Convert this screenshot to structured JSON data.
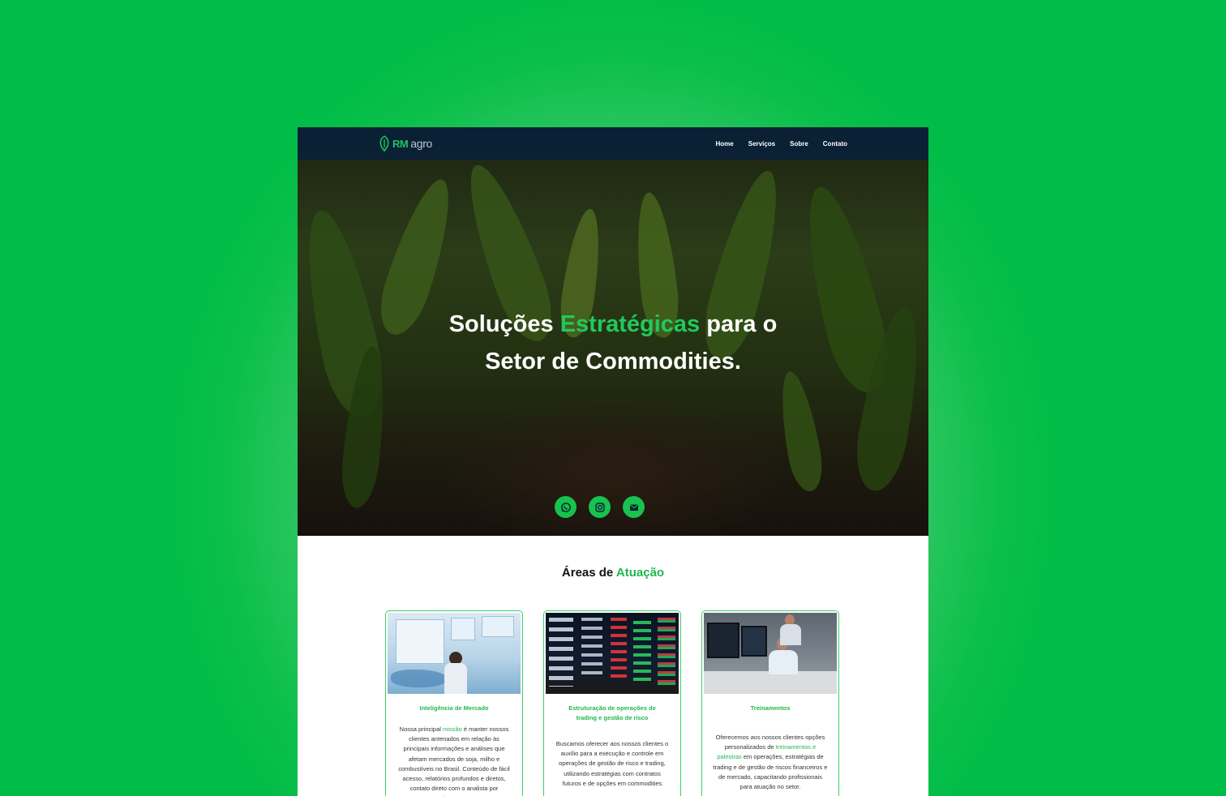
{
  "brand": {
    "rm": "RM",
    "agro": "agro",
    "color": "#1fc35a"
  },
  "nav": {
    "items": [
      "Home",
      "Serviços",
      "Sobre",
      "Contato"
    ]
  },
  "hero": {
    "line1_pre": "Soluções ",
    "line1_accent": "Estratégicas",
    "line1_post": " para o",
    "line2": "Setor de Commodities.",
    "social_icons": [
      "whatsapp-icon",
      "instagram-icon",
      "email-icon"
    ]
  },
  "areas": {
    "title_pre": "Áreas de ",
    "title_accent": "Atuação",
    "cards": [
      {
        "title": "Inteligência de Mercado",
        "text_pre": "Nossa principal ",
        "text_hl": "missão",
        "text_post": " é manter nossos clientes antenados em relação às principais informações e análises que afetam mercados de soja, milho e combustíveis no Brasil. Conteúdo de fácil acesso, relatórios profundos e diretos, contato direto com o analista por WhatsApp e"
      },
      {
        "title": "Estruturação de operações de trading e gestão de risco",
        "text_pre": "Buscamos oferecer aos nossos clientes o auxílio para a execução e controle em operações de gestão de risco e trading, utilizando estratégias com contratos futuros e de opções em commodities",
        "text_hl": "",
        "text_post": ""
      },
      {
        "title": "Treinamentos",
        "text_pre": "Oferecemos aos nossos clientes opções personalizados de ",
        "text_hl": "treinamentos e palestras",
        "text_post": " em operações, estratégias de trading e de gestão de riscos financeiros e de mercado, capacitando profissionais para atuação no setor."
      }
    ]
  },
  "colors": {
    "accent": "#1fb850",
    "nav_bg": "#0a2034",
    "page_bg": "#00bc48"
  }
}
